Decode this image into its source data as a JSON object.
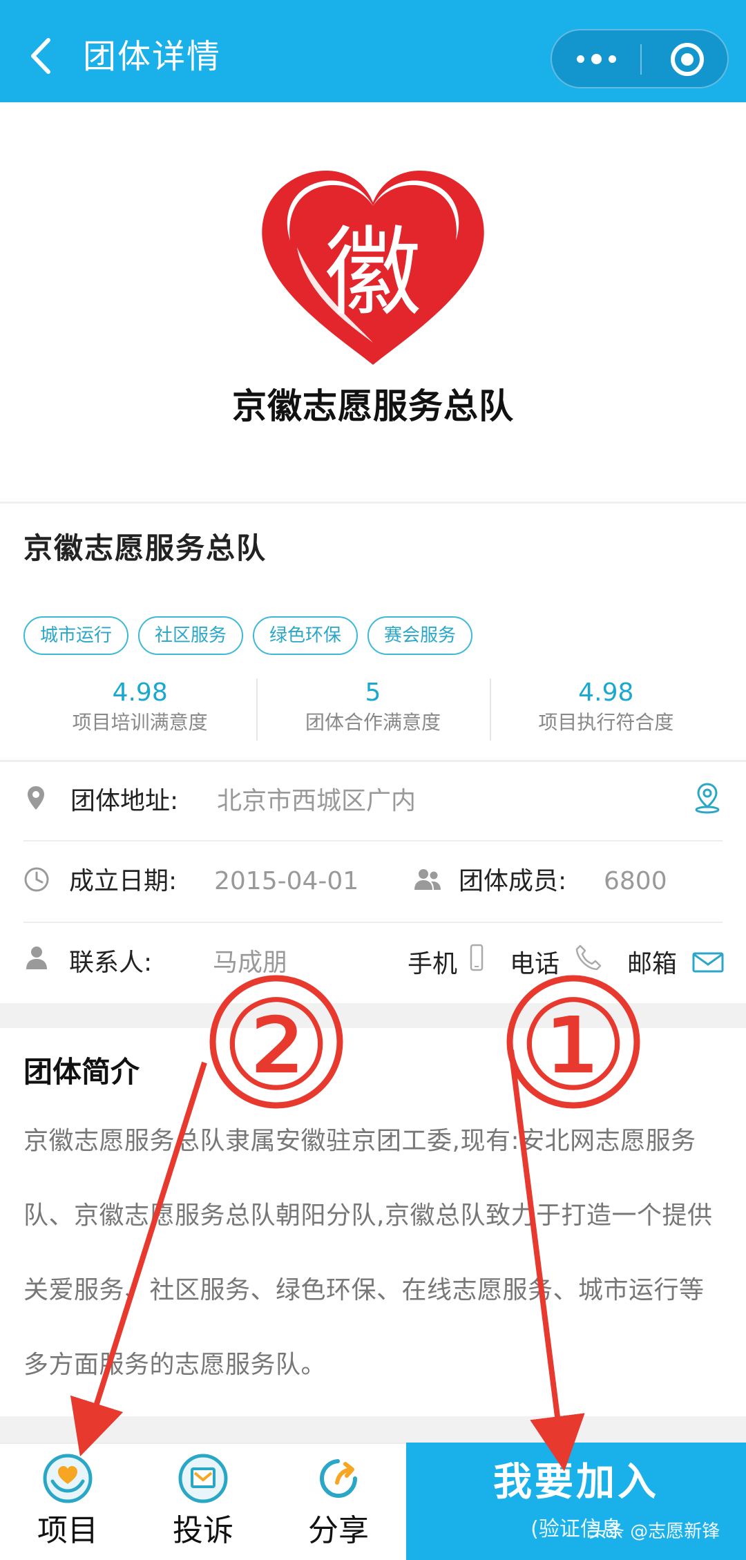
{
  "header": {
    "title": "团体详情",
    "back_icon": "chevron-left-icon",
    "more_icon": "more-dots-icon",
    "close_icon": "target-circle-icon"
  },
  "logo": {
    "caption": "京徽志愿服务总队",
    "glyph": "徽",
    "colors": {
      "heart": "#e3262c"
    }
  },
  "team": {
    "name": "京徽志愿服务总队",
    "tags": [
      "城市运行",
      "社区服务",
      "绿色环保",
      "赛会服务"
    ],
    "stats": [
      {
        "value": "4.98",
        "label": "项目培训满意度"
      },
      {
        "value": "5",
        "label": "团体合作满意度"
      },
      {
        "value": "4.98",
        "label": "项目执行符合度"
      }
    ]
  },
  "info": {
    "address_label": "团体地址:",
    "address_value": "北京市西城区广内",
    "founded_label": "成立日期:",
    "founded_value": "2015-04-01",
    "members_label": "团体成员:",
    "members_value": "6800",
    "contact_label": "联系人:",
    "contact_value": "马成朋",
    "mobile_label": "手机",
    "phone_label": "电话",
    "email_label": "邮箱"
  },
  "intro": {
    "title": "团体简介",
    "text": "京徽志愿服务总队隶属安徽驻京团工委,现有:安北网志愿服务队、京徽志愿服务总队朝阳分队,京徽总队致力于打造一个提供关爱服务、社区服务、绿色环保、在线志愿服务、城市运行等多方面服务的志愿服务队。"
  },
  "annotations": {
    "circle_1": "①",
    "circle_2": "②",
    "color": "#e8392f"
  },
  "bottom_bar": {
    "tabs": [
      {
        "label": "项目",
        "icon": "project-heart-hand-icon"
      },
      {
        "label": "投诉",
        "icon": "complaint-letter-icon"
      },
      {
        "label": "分享",
        "icon": "share-arrow-icon"
      }
    ],
    "join_main": "我要加入",
    "join_sub": "(验证信息",
    "accent": "#1ab0ea"
  },
  "watermark": "头条 @志愿新锋"
}
